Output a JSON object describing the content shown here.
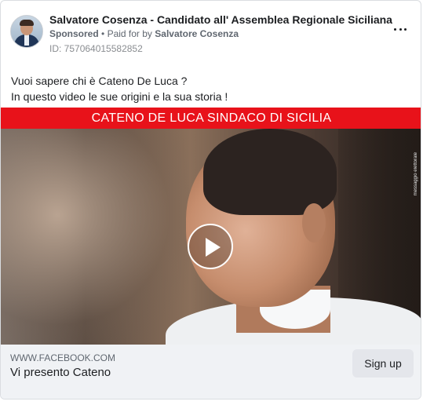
{
  "ad": {
    "page_name": "Salvatore Cosenza - Candidato all' Assemblea Regionale Siciliana",
    "sponsored_label": "Sponsored",
    "separator": "•",
    "paid_for_prefix": "Paid for by",
    "paid_for_name": "Salvatore Cosenza",
    "ad_id": "ID: 757064015582852",
    "body_line1": "Vuoi sapere chi è Cateno De Luca ?",
    "body_line2": "In questo video le sue origini e la sua storia !"
  },
  "media": {
    "banner_text": "CATENO DE LUCA SINDACO DI SICILIA",
    "watermark": "messaggio elettorale",
    "play_icon": "play-icon"
  },
  "link": {
    "domain": "WWW.FACEBOOK.COM",
    "title": "Vi presento Cateno",
    "cta_label": "Sign up"
  },
  "colors": {
    "banner_red": "#e8121a",
    "footer_bg": "#f0f2f5",
    "text_primary": "#1c1e21",
    "text_secondary": "#606770"
  }
}
